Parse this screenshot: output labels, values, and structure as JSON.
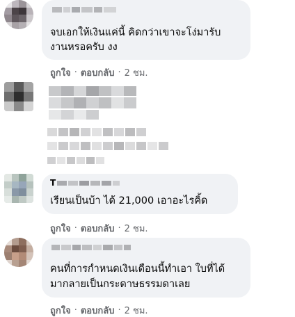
{
  "comments": [
    {
      "text_line1": "จบเอกให้เงินแค่นี้ คิดกว่าเขาจะโง่มารับ",
      "text_line2": "งานหรอครับ งง",
      "like_label": "ถูกใจ",
      "reply_label": "ตอบกลับ",
      "time_label": "2 ชม.",
      "separator": "·"
    },
    {
      "like_label": "",
      "reply_label": "",
      "time_label": ""
    },
    {
      "name_initial": "T",
      "text_line1": "เรียนเป็นบ้า ได้ 21,000 เอาอะไรคิ้ด",
      "like_label": "ถูกใจ",
      "reply_label": "ตอบกลับ",
      "time_label": "2 ชม.",
      "separator": "·"
    },
    {
      "text_line1": "คนที่การกำหนดเงินเดือนนี้ทำเอา ใบที่ได้",
      "text_line2": "มากลายเป็นกระดาษธรรมดาเลย",
      "like_label": "ถูกใจ",
      "reply_label": "ตอบกลับ",
      "time_label": "2 ชม.",
      "separator": "·"
    }
  ]
}
